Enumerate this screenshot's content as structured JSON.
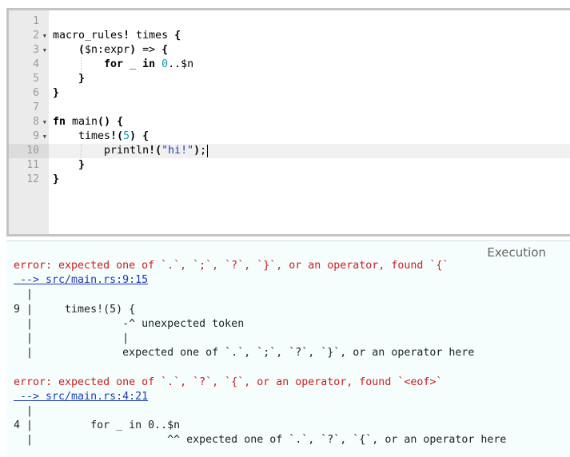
{
  "editor": {
    "lines": [
      {
        "num": "1",
        "fold": false,
        "text": ""
      },
      {
        "num": "2",
        "fold": true,
        "text": "macro_rules! times {"
      },
      {
        "num": "3",
        "fold": true,
        "text": "    ($n:expr) => {"
      },
      {
        "num": "4",
        "fold": false,
        "text": "        for _ in 0..$n"
      },
      {
        "num": "5",
        "fold": false,
        "text": "    }"
      },
      {
        "num": "6",
        "fold": false,
        "text": "}"
      },
      {
        "num": "7",
        "fold": false,
        "text": ""
      },
      {
        "num": "8",
        "fold": true,
        "text": "fn main() {"
      },
      {
        "num": "9",
        "fold": true,
        "text": "    times!(5) {"
      },
      {
        "num": "10",
        "fold": false,
        "text": "        println!(\"hi!\");"
      },
      {
        "num": "11",
        "fold": false,
        "text": "    }"
      },
      {
        "num": "12",
        "fold": false,
        "text": "}"
      }
    ],
    "active_line": "10"
  },
  "output": {
    "title": "Execution",
    "lines": [
      {
        "kind": "err",
        "text": "error: expected one of `.`, `;`, `?`, `}`, or an operator, found `{`"
      },
      {
        "kind": "loc",
        "text": " --> src/main.rs:9:15"
      },
      {
        "kind": "plain",
        "text": "  |"
      },
      {
        "kind": "plain",
        "text": "9 |     times!(5) {"
      },
      {
        "kind": "plain",
        "text": "  |              -^ unexpected token"
      },
      {
        "kind": "plain",
        "text": "  |              |"
      },
      {
        "kind": "plain",
        "text": "  |              expected one of `.`, `;`, `?`, `}`, or an operator here"
      },
      {
        "kind": "plain",
        "text": ""
      },
      {
        "kind": "err",
        "text": "error: expected one of `.`, `?`, `{`, or an operator, found `<eof>`"
      },
      {
        "kind": "loc",
        "text": " --> src/main.rs:4:21"
      },
      {
        "kind": "plain",
        "text": "  |"
      },
      {
        "kind": "plain",
        "text": "4 |         for _ in 0..$n"
      },
      {
        "kind": "plain",
        "text": "  |                     ^^ expected one of `.`, `?`, `{`, or an operator here"
      }
    ]
  }
}
